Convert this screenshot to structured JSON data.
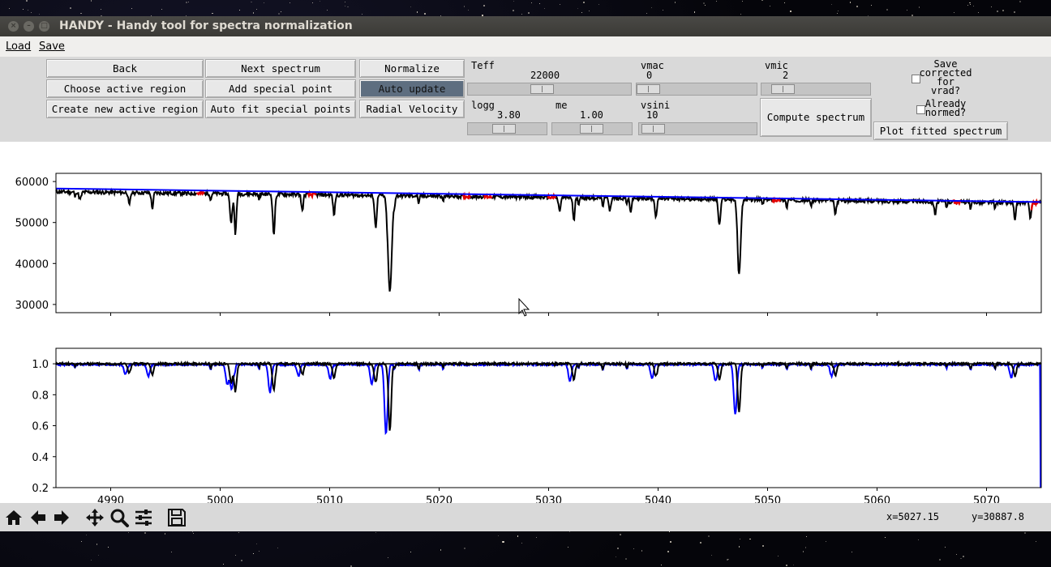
{
  "window": {
    "title": "HANDY - Handy tool for spectra normalization",
    "close_glyph": "×",
    "minimize_glyph": "–",
    "maximize_glyph": "□"
  },
  "menu": {
    "load": "Load",
    "save": "Save"
  },
  "buttons": {
    "back": "Back",
    "next_spectrum": "Next spectrum",
    "normalize": "Normalize",
    "choose_active_region": "Choose active region",
    "add_special_point": "Add special point",
    "auto_update": "Auto update",
    "create_new_active_region": "Create new active region",
    "auto_fit_special_points": "Auto fit special points",
    "radial_velocity": "Radial Velocity",
    "compute_spectrum": "Compute spectrum",
    "plot_fitted_spectrum": "Plot fitted spectrum"
  },
  "params": {
    "teff": {
      "label": "Teff",
      "value": "22000",
      "level": 0.45
    },
    "vmac": {
      "label": "vmac",
      "value": "0",
      "level": 0.0
    },
    "vmic": {
      "label": "vmic",
      "value": "2",
      "level": 0.12
    },
    "logg": {
      "label": "logg",
      "value": "3.80",
      "level": 0.45
    },
    "me": {
      "label": "me",
      "value": "1.00",
      "level": 0.5
    },
    "vsini": {
      "label": "vsini",
      "value": "10",
      "level": 0.03
    }
  },
  "checks": {
    "save_corrected": "Save\ncorrected\nfor\nvrad?",
    "save_corrected_checked": false,
    "already_normed": "Already\nnormed?",
    "already_normed_checked": false
  },
  "status": {
    "x": "x=5027.15",
    "y": "y=30887.8"
  },
  "toolbar_icons": [
    "home-icon",
    "back-arrow-icon",
    "forward-arrow-icon",
    "pan-icon",
    "zoom-icon",
    "subplots-icon",
    "save-figure-icon"
  ],
  "colors": {
    "spectrum": "#000000",
    "continuum": "#0000ff",
    "special_points": "#e00000",
    "model": "#0000ff",
    "auto_update_active": "#5e6e80"
  },
  "chart_data": [
    {
      "type": "line",
      "xlim": [
        4985,
        5075
      ],
      "ylim": [
        28000,
        62000
      ],
      "xticks": [
        4990,
        5000,
        5010,
        5020,
        5030,
        5040,
        5050,
        5060,
        5070
      ],
      "yticks": [
        30000,
        40000,
        50000,
        60000
      ],
      "continuum": {
        "x": [
          4985,
          5075
        ],
        "y": [
          58300,
          55000
        ]
      },
      "spectrum_base": {
        "x": [
          4985,
          5075
        ],
        "y": [
          57500,
          54800
        ]
      },
      "lines": [
        {
          "x": 4987.2,
          "depth": 1800,
          "w": 0.15
        },
        {
          "x": 4991.7,
          "depth": 3200,
          "w": 0.12
        },
        {
          "x": 4993.8,
          "depth": 3800,
          "w": 0.12
        },
        {
          "x": 5001.0,
          "depth": 7000,
          "w": 0.15
        },
        {
          "x": 5001.4,
          "depth": 8600,
          "w": 0.12
        },
        {
          "x": 5004.9,
          "depth": 9800,
          "w": 0.14
        },
        {
          "x": 5007.5,
          "depth": 4000,
          "w": 0.12
        },
        {
          "x": 5010.4,
          "depth": 5000,
          "w": 0.12
        },
        {
          "x": 5014.2,
          "depth": 7800,
          "w": 0.14
        },
        {
          "x": 5015.5,
          "depth": 23500,
          "w": 0.25
        },
        {
          "x": 5031.0,
          "depth": 3300,
          "w": 0.14
        },
        {
          "x": 5032.3,
          "depth": 5800,
          "w": 0.12
        },
        {
          "x": 5035.6,
          "depth": 3000,
          "w": 0.12
        },
        {
          "x": 5037.5,
          "depth": 3200,
          "w": 0.12
        },
        {
          "x": 5039.8,
          "depth": 4500,
          "w": 0.12
        },
        {
          "x": 5045.6,
          "depth": 6500,
          "w": 0.14
        },
        {
          "x": 5047.4,
          "depth": 18500,
          "w": 0.2
        },
        {
          "x": 5056.2,
          "depth": 3300,
          "w": 0.12
        },
        {
          "x": 5065.3,
          "depth": 3000,
          "w": 0.12
        },
        {
          "x": 5072.6,
          "depth": 4500,
          "w": 0.12
        },
        {
          "x": 5074.0,
          "depth": 3500,
          "w": 0.12
        }
      ],
      "special_points": [
        4998.2,
        5008.4,
        5022.5,
        5024.5,
        5030.3,
        5050.8,
        5067.3,
        5074.5
      ]
    },
    {
      "type": "line",
      "xlim": [
        4985,
        5075
      ],
      "ylim": [
        0.2,
        1.1
      ],
      "xticks": [
        4990,
        5000,
        5010,
        5020,
        5030,
        5040,
        5050,
        5060,
        5070
      ],
      "yticks": [
        0.2,
        0.4,
        0.6,
        0.8,
        1.0
      ],
      "unity_line": 1.0,
      "normalized_lines": [
        {
          "x": 4991.7,
          "depth": 0.06
        },
        {
          "x": 4993.8,
          "depth": 0.07
        },
        {
          "x": 5001.0,
          "depth": 0.12
        },
        {
          "x": 5001.4,
          "depth": 0.15
        },
        {
          "x": 5004.9,
          "depth": 0.17
        },
        {
          "x": 5007.5,
          "depth": 0.07
        },
        {
          "x": 5010.4,
          "depth": 0.09
        },
        {
          "x": 5014.2,
          "depth": 0.12
        },
        {
          "x": 5015.5,
          "depth": 0.43
        },
        {
          "x": 5032.3,
          "depth": 0.1
        },
        {
          "x": 5039.8,
          "depth": 0.08
        },
        {
          "x": 5045.6,
          "depth": 0.1
        },
        {
          "x": 5047.4,
          "depth": 0.31
        },
        {
          "x": 5056.2,
          "depth": 0.07
        },
        {
          "x": 5072.6,
          "depth": 0.08
        }
      ],
      "model_shift": -0.35,
      "model_end_drop": 0.2
    }
  ]
}
